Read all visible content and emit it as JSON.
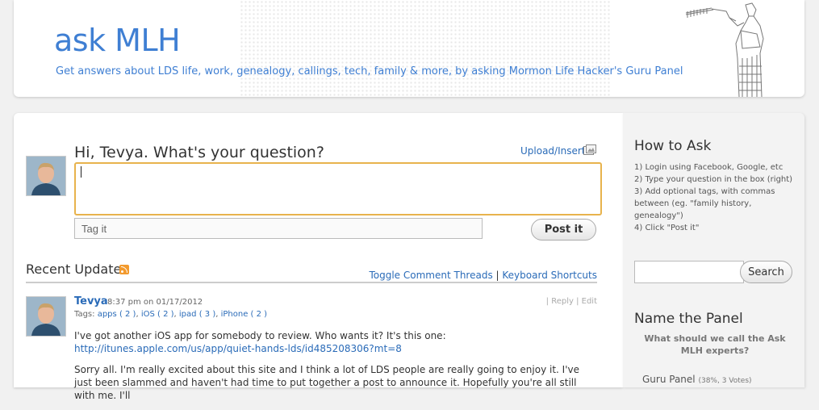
{
  "header": {
    "site_title": "ask MLH",
    "tagline": "Get answers about LDS life, work, genealogy, callings, tech, family & more, by asking Mormon Life Hacker's Guru Panel"
  },
  "composer": {
    "greeting": "Hi, Tevya. What's your question?",
    "upload_label": "Upload/Insert",
    "question_value": "",
    "tag_placeholder": "Tag it",
    "post_button": "Post it"
  },
  "updates": {
    "title": "Recent Updates",
    "toggle_threads": "Toggle Comment Threads",
    "separator": "|",
    "keyboard_shortcuts": "Keyboard Shortcuts",
    "post": {
      "author": "Tevya",
      "time": "8:37 pm on 01/17/2012",
      "tags_label": "Tags:",
      "tags": [
        {
          "label": "apps",
          "count": "( 2 )"
        },
        {
          "label": "iOS",
          "count": "( 2 )"
        },
        {
          "label": "ipad",
          "count": "( 3 )"
        },
        {
          "label": "iPhone",
          "count": "( 2 )"
        }
      ],
      "reply": "| Reply",
      "edit": "| Edit",
      "paragraph1": "I've got another iOS app for somebody to review. Who wants it? It's this one:",
      "link": "http://itunes.apple.com/us/app/quiet-hands-lds/id485208306?mt=8",
      "paragraph2": "Sorry all. I'm really excited about this site and I think a lot of LDS people are really going to enjoy it. I've just been slammed and haven't had time to put together a post to announce it. Hopefully you're all still with me. I'll"
    }
  },
  "sidebar": {
    "how_title": "How to Ask",
    "steps": [
      "1) Login using Facebook, Google, etc",
      "2) Type your question in the box (right)",
      "3) Add optional tags, with commas between (eg. \"family history, genealogy\")",
      "4) Click \"Post it\""
    ],
    "search_value": "",
    "search_button": "Search",
    "panel_title": "Name the Panel",
    "poll_question": "What should we call the Ask MLH experts?",
    "poll_option": "Guru Panel",
    "poll_option_stat": "(38%, 3 Votes)"
  },
  "icons": {
    "upload": "image-upload-icon",
    "rss": "rss-icon",
    "angel": "angel-moroni-icon"
  },
  "colors": {
    "accent": "#3f7fd3",
    "link": "#2a6bb8",
    "focus_border": "#e8b34d",
    "rss": "#f29a2e"
  }
}
